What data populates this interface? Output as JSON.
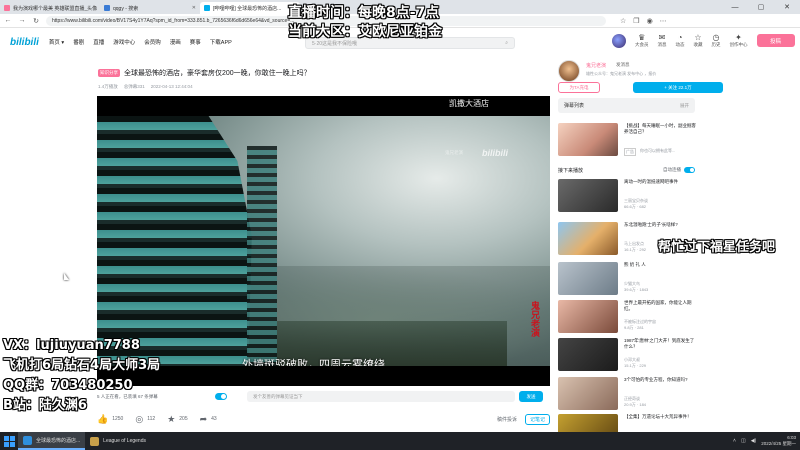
{
  "browser": {
    "tabs": [
      {
        "title": "我为演戏哪个最美 英雄联盟直播_头像"
      },
      {
        "title": "qqgy - 搜索"
      },
      {
        "title": "[哔哩哔哩] 全球最恐怖的酒店..."
      }
    ],
    "url": "https://www.bilibili.com/video/BV17S4y1Y7Aq?spm_id_from=333.851.b_7265636f6d6d656e64&vd_source=...",
    "window_controls": [
      "—",
      "▢",
      "✕"
    ]
  },
  "site": {
    "logo": "bilibili",
    "nav": [
      "首页 ▾",
      "番剧",
      "直播",
      "游戏中心",
      "会员购",
      "漫画",
      "赛事",
      "下载APP"
    ],
    "search_placeholder": "5·20这是我不保险哦",
    "user_nav": [
      "大会员",
      "消息",
      "动态",
      "收藏",
      "历史",
      "创作中心"
    ],
    "upload_label": "投稿"
  },
  "video": {
    "tag": "知识分享",
    "title": "全球最恐怖的酒店，豪华套房仅200一晚，你敢住一晚上吗？",
    "meta": [
      "1.4万播放",
      "总弹幕331",
      "2022-04-13 12:44:04"
    ],
    "player_hotel_text": "凯撒大酒店",
    "watermark": "bilibili",
    "watermark_sub": "鬼兄老演",
    "subtitle": "外墙斑驳破败，四周云雾缭绕",
    "seal": "鬼兄老演",
    "danmaku_viewers": "5 人正在看，已装填 67 条弹幕",
    "danmaku_placeholder": "发个友善的弹幕见证当下",
    "danmaku_send": "发送",
    "likes": "1250",
    "coins": "112",
    "favs": "205",
    "shares": "43",
    "report": "稿件投诉",
    "notes": "记笔记"
  },
  "uploader": {
    "name": "鬼兄老演",
    "msg": "发消息",
    "desc": "雄性公众号：鬼兄老演 发布中心 ，报价",
    "charge": "为TA充电",
    "follow": "+ 关注 22.1万"
  },
  "sidebar": {
    "danmaku_list": "弹幕列表",
    "danmaku_list_more": "展开",
    "ad": {
      "title": "【挑战】每天睡眠一小时，副业掘客养活自己？",
      "author": "广告",
      "stats": "你也可以拥有此等..."
    },
    "autoplay_label": "接下来播放",
    "autoplay_switch": "自动连播",
    "recos": [
      {
        "title": "离动一时的温抵速网吧事件",
        "author": "三丽宝贝杂谈",
        "stats": "66.6万 · 682"
      },
      {
        "title": "东北温啪跑'士的子'长啥样?",
        "author": "马上出发点",
        "stats": "16.1万 · 292"
      },
      {
        "title": "熊 奶 礼 人",
        "author": "少猫大鸟",
        "stats": "39.6万 · 1843"
      },
      {
        "title": "世界上最开拓的国家，你能让人期红。",
        "author": "不被标注过的宇宙",
        "stats": "9.8万 · 281"
      },
      {
        "title": "1987年'唐林'之门大开！到底发生了什么？",
        "author": "小邓大叔",
        "stats": "15.1万 · 229"
      },
      {
        "title": "3个可怕的专业方程，你知道吗?",
        "author": "正经奇谈",
        "stats": "20.9万 · 184"
      },
      {
        "title": "【全集】万遗论坛十大荒异事件！",
        "author": "灵异档案",
        "stats": ""
      }
    ]
  },
  "overlay": {
    "line1": "直播时间：每晚8点-7点",
    "line2": "当前大区：艾欧尼亚铂金",
    "right": "帮忙过下福星任务吧",
    "vx": "VX：lujiuyuan7788",
    "rank": "飞机打6局钻石4局大师3局",
    "qq": "QQ群：703480250",
    "bzhan": "B站：陆久渊6"
  },
  "taskbar": {
    "items": [
      "全球最恐怖的酒店...",
      "League of Legends"
    ],
    "time": "6:03",
    "date": "2022/4/25 星期一"
  },
  "colors": {
    "accent": "#00aeec",
    "pink": "#fb7299"
  }
}
